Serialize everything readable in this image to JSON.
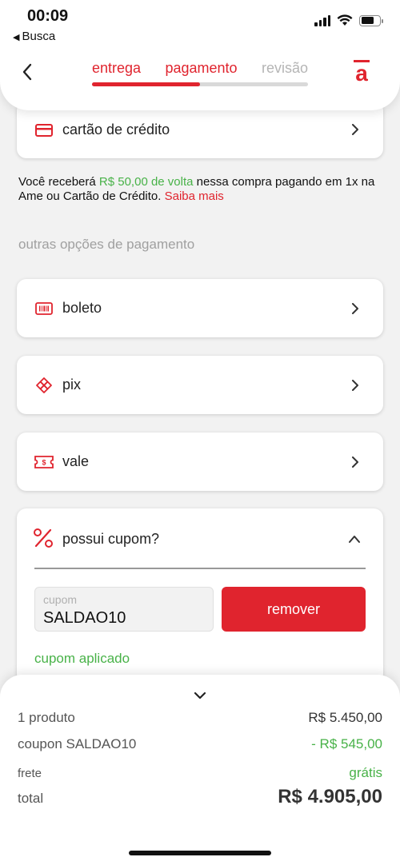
{
  "status_bar": {
    "time": "00:09",
    "back_app": "Busca"
  },
  "header": {
    "steps": [
      "entrega",
      "pagamento",
      "revisão"
    ],
    "progress_fraction": 0.5,
    "logo_letter": "a"
  },
  "payment": {
    "credit_card": {
      "label": "cartão de crédito"
    },
    "info": {
      "text_1": "Você receberá ",
      "cashback": "R$ 50,00 de volta",
      "text_2": " nessa compra pagando em 1x na Ame ou Cartão de Crédito. ",
      "link": "Saiba mais"
    },
    "other_title": "outras opções de pagamento",
    "options": [
      {
        "label": "boleto",
        "icon": "barcode-icon"
      },
      {
        "label": "pix",
        "icon": "pix-icon"
      },
      {
        "label": "vale",
        "icon": "voucher-icon"
      }
    ]
  },
  "coupon": {
    "title": "possui cupom?",
    "placeholder": "cupom",
    "value": "SALDAO10",
    "remove_label": "remover",
    "applied_label": "cupom aplicado"
  },
  "summary": {
    "products_label": "1 produto",
    "products_value": "R$ 5.450,00",
    "coupon_label": "coupon SALDAO10",
    "coupon_value": "- R$ 545,00",
    "shipping_label": "frete",
    "shipping_value": "grátis",
    "total_label": "total",
    "total_value": "R$ 4.905,00"
  },
  "colors": {
    "accent": "#e0242e",
    "success": "#48b248",
    "muted": "#a0a0a0"
  }
}
